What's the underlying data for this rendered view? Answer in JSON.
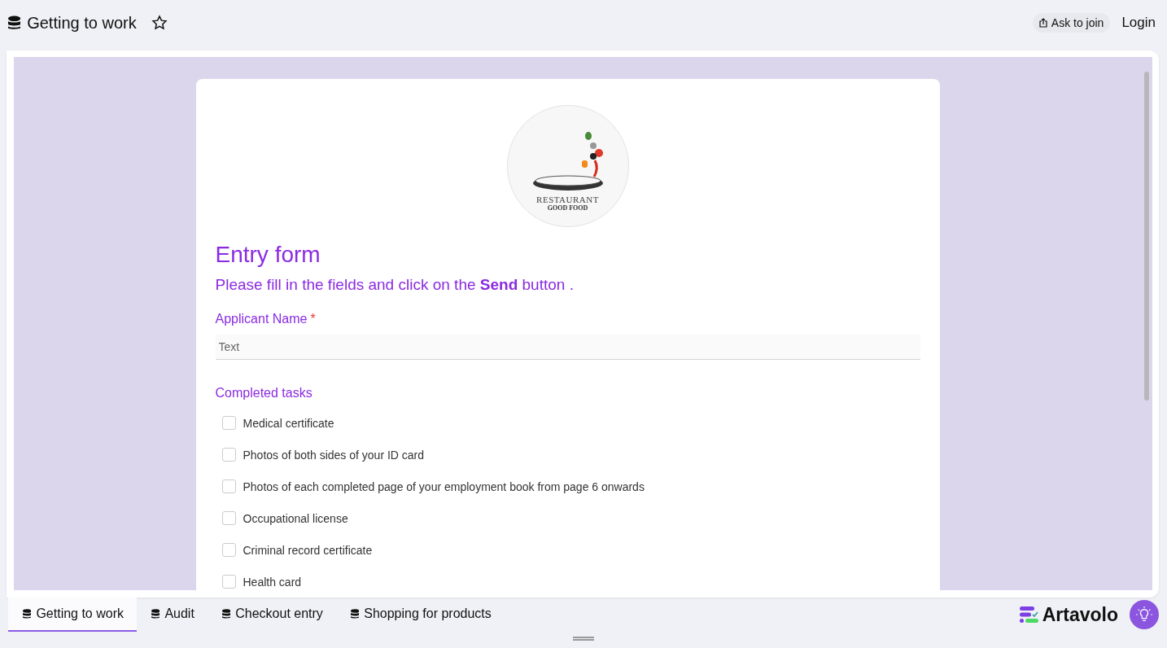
{
  "header": {
    "title": "Getting to work",
    "starred": false,
    "ask_to_join": "Ask to join",
    "login": "Login"
  },
  "form": {
    "logo": {
      "name": "RESTAURANT",
      "tagline": "GOOD FOOD"
    },
    "title": "Entry form",
    "subtitle": "Please fill in the fields and click on the **Send** button .",
    "name_field": {
      "label": "Applicant Name",
      "required_mark": "*",
      "placeholder": "Text"
    },
    "tasks": {
      "label": "Completed tasks",
      "items": [
        {
          "label": "Medical certificate",
          "checked": false
        },
        {
          "label": "Photos of both sides of your ID card",
          "checked": false
        },
        {
          "label": "Photos of each completed page of your employment book from page 6 onwards",
          "checked": false
        },
        {
          "label": "Occupational license",
          "checked": false
        },
        {
          "label": "Criminal record certificate",
          "checked": false
        },
        {
          "label": "Health card",
          "checked": false
        }
      ]
    }
  },
  "tabs": [
    {
      "label": "Getting to work",
      "selected": true
    },
    {
      "label": "Audit",
      "selected": false
    },
    {
      "label": "Checkout entry",
      "selected": false
    },
    {
      "label": "Shopping for products",
      "selected": false
    }
  ],
  "brand": {
    "name": "Artavolo"
  }
}
